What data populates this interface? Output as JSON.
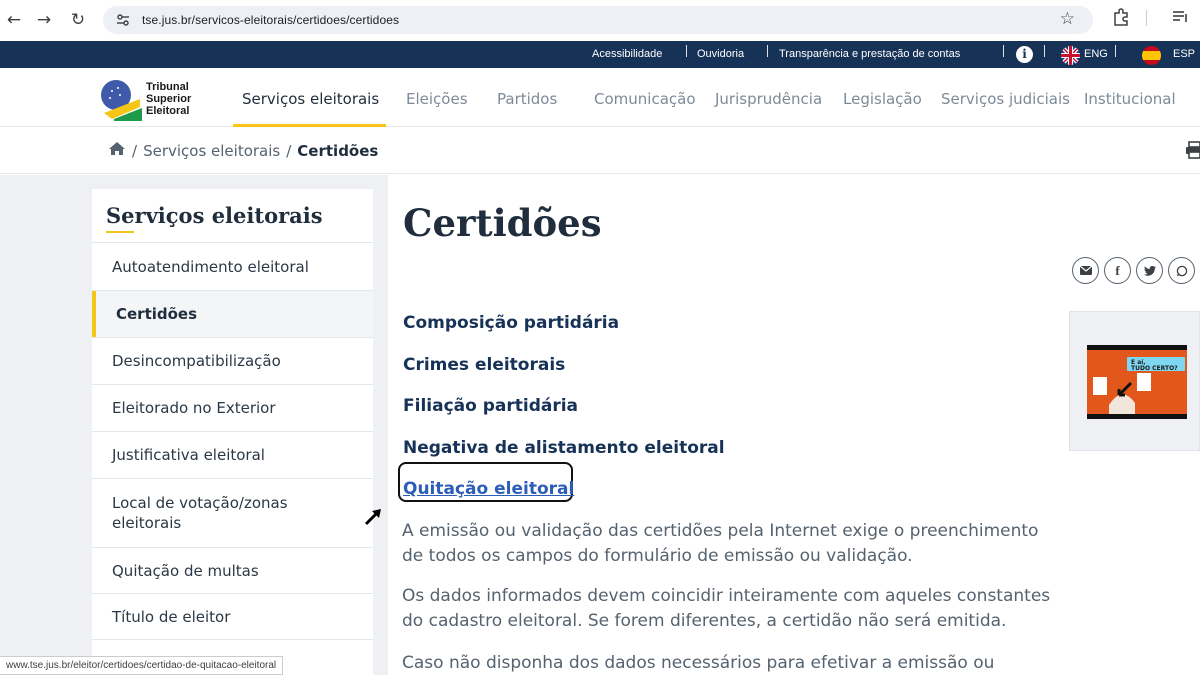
{
  "browser": {
    "url": "tse.jus.br/servicos-eleitorais/certidoes/certidoes",
    "back_icon": "←",
    "forward_icon": "→",
    "reload_icon": "↻"
  },
  "utility_bar": {
    "items": [
      "Acessibilidade",
      "Ouvidoria",
      "Transparência e prestação de contas"
    ],
    "eng_label": "ENG",
    "esp_label": "ESP",
    "info_glyph": "i"
  },
  "logo": {
    "line1": "Tribunal",
    "line2": "Superior",
    "line3": "Eleitoral"
  },
  "menu": {
    "items": [
      "Serviços eleitorais",
      "Eleições",
      "Partidos",
      "Comunicação",
      "Jurisprudência",
      "Legislação",
      "Serviços judiciais",
      "Institucional"
    ],
    "active_index": 0
  },
  "breadcrumb": {
    "home_icon": "home-icon",
    "sep": "/",
    "parent": "Serviços eleitorais",
    "current": "Certidões"
  },
  "sidebar": {
    "title": "Serviços eleitorais",
    "items": [
      "Autoatendimento eleitoral",
      "Certidões",
      "Desincompatibilização",
      "Eleitorado no Exterior",
      "Justificativa eleitoral",
      "Local de votação/zonas eleitorais",
      "Quitação de multas",
      "Título de eleitor"
    ],
    "active_index": 1
  },
  "main": {
    "title": "Certidões",
    "links": [
      "Composição partidária",
      "Crimes eleitorais",
      "Filiação partidária",
      "Negativa de alistamento eleitoral",
      "Quitação eleitoral"
    ],
    "paragraphs": [
      "A emissão ou validação das certidões pela Internet exige o preenchimento de todos os campos do formulário de emissão ou validação.",
      "Os dados informados devem coincidir inteiramente com aqueles constantes do cadastro eleitoral. Se forem diferentes, a certidão não será emitida.",
      "Caso não disponha dos dados necessários para efetivar a emissão ou"
    ]
  },
  "video": {
    "caption1": "E aí,",
    "caption2": "TUDO CERTO?"
  },
  "status_bar": {
    "text": "www.tse.jus.br/eleitor/certidoes/certidao-de-quitacao-eleitoral"
  },
  "colors": {
    "navy": "#173257",
    "accent_yellow": "#f5c518",
    "link_blue": "#2c5db7"
  }
}
